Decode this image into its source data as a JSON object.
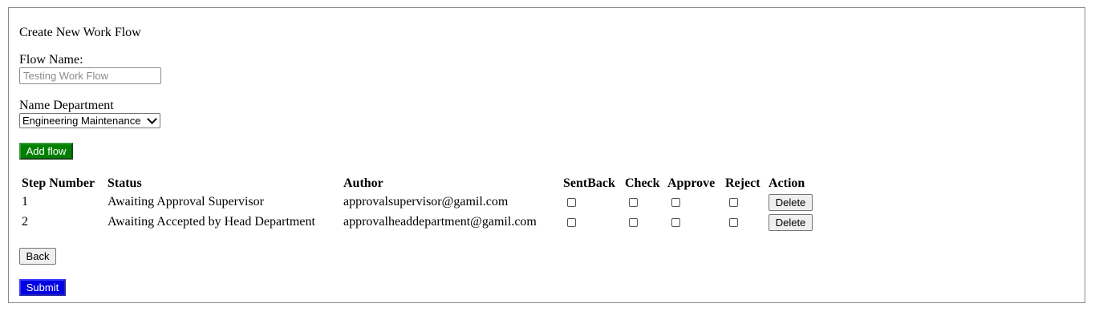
{
  "page": {
    "title": "Create New Work Flow"
  },
  "form": {
    "flow_name_label": "Flow Name:",
    "flow_name_placeholder": "Testing Work Flow",
    "department_label": "Name Department",
    "department_selected": "Engineering Maintenance",
    "add_flow_label": "Add flow"
  },
  "table": {
    "headers": [
      "Step Number",
      "Status",
      "Author",
      "SentBack",
      "Check",
      "Approve",
      "Reject",
      "Action"
    ],
    "rows": [
      {
        "step": "1",
        "status": "Awaiting Approval Supervisor",
        "author": "approvalsupervisor@gamil.com",
        "sentback": false,
        "check": false,
        "approve": false,
        "reject": false,
        "action_label": "Delete"
      },
      {
        "step": "2",
        "status": "Awaiting Accepted by Head Department",
        "author": "approvalheaddepartment@gamil.com",
        "sentback": false,
        "check": false,
        "approve": false,
        "reject": false,
        "action_label": "Delete"
      }
    ]
  },
  "actions": {
    "back_label": "Back",
    "submit_label": "Submit"
  },
  "colors": {
    "add_flow_bg": "#008000",
    "submit_bg": "#0000e0"
  }
}
